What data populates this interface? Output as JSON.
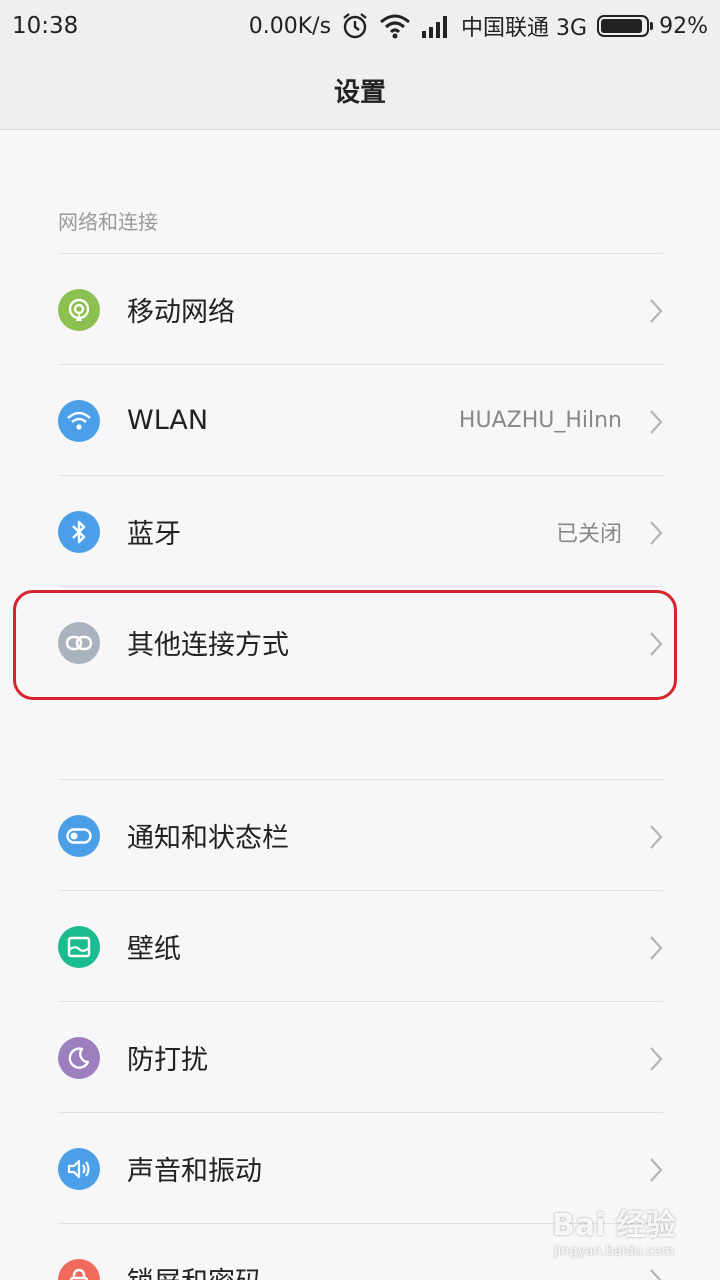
{
  "status": {
    "time": "10:38",
    "speed": "0.00K/s",
    "carrier": "中国联通 3G",
    "battery": "92%",
    "battery_level": 0.92
  },
  "header": {
    "title": "设置"
  },
  "section": {
    "label": "网络和连接"
  },
  "rows": [
    {
      "label": "移动网络",
      "value": "",
      "icon": "mobile-network-icon",
      "color": "#8cc152"
    },
    {
      "label": "WLAN",
      "value": "HUAZHU_Hilnn",
      "icon": "wifi-icon",
      "color": "#4a9fe8"
    },
    {
      "label": "蓝牙",
      "value": "已关闭",
      "icon": "bluetooth-icon",
      "color": "#4a9fe8"
    },
    {
      "label": "其他连接方式",
      "value": "",
      "icon": "link-icon",
      "color": "#aab2bd"
    },
    {
      "label": "通知和状态栏",
      "value": "",
      "icon": "toggle-icon",
      "color": "#4a9fe8"
    },
    {
      "label": "壁纸",
      "value": "",
      "icon": "wallpaper-icon",
      "color": "#1bbc8f"
    },
    {
      "label": "防打扰",
      "value": "",
      "icon": "moon-icon",
      "color": "#9b7fbf"
    },
    {
      "label": "声音和振动",
      "value": "",
      "icon": "speaker-icon",
      "color": "#4a9fe8"
    },
    {
      "label": "锁屏和密码",
      "value": "",
      "icon": "lock-icon",
      "color": "#f06b5c"
    }
  ],
  "watermark": {
    "main": "Bai 经验",
    "sub": "jingyan.baidu.com"
  }
}
